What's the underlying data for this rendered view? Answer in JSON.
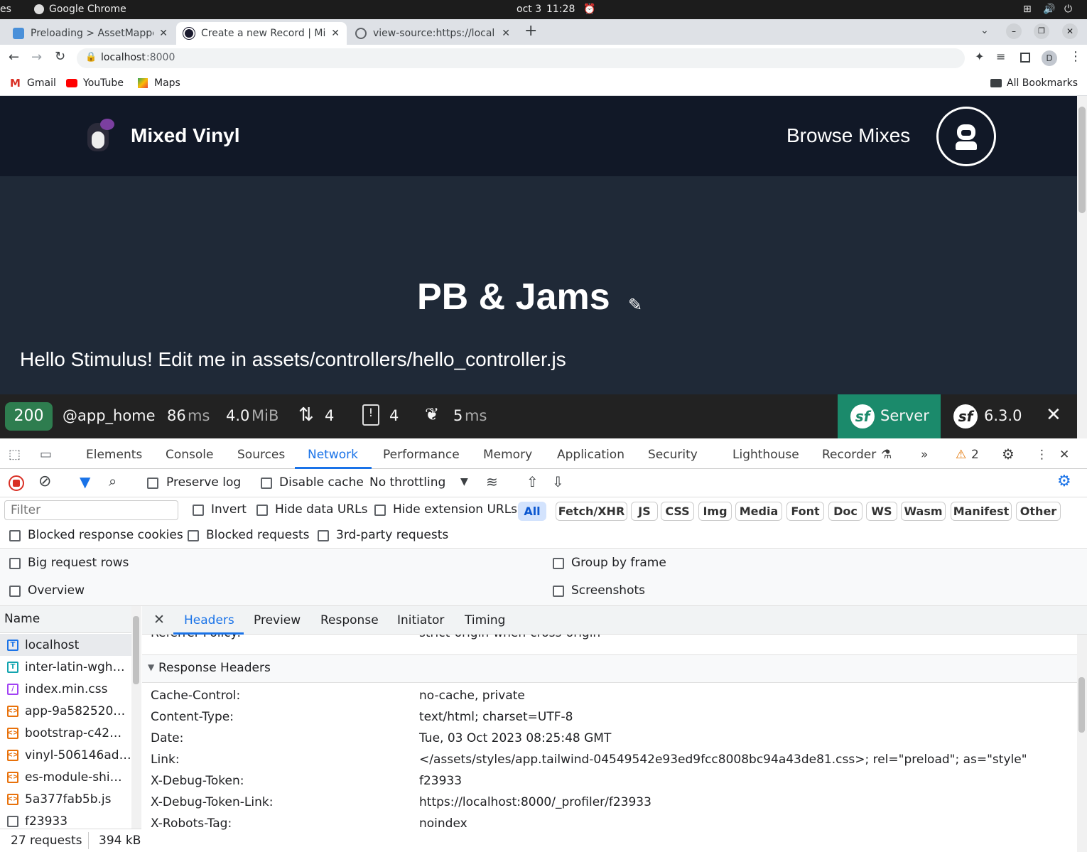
{
  "os": {
    "left_fragment": "es",
    "app": "Google Chrome",
    "date": "oct 3",
    "time": "11:28"
  },
  "tabs": [
    {
      "title": "Preloading > AssetMappe",
      "fav_color": "#4a90d9"
    },
    {
      "title": "Create a new Record | Mi",
      "fav_color": "#1a1a2e"
    },
    {
      "title": "view-source:https://local",
      "fav_color": "#5f6368"
    }
  ],
  "address": {
    "host": "localhost",
    "port": ":8000"
  },
  "bookmarks": {
    "items": [
      "Gmail",
      "YouTube",
      "Maps"
    ],
    "all": "All Bookmarks"
  },
  "profile_initial": "D",
  "site": {
    "brand": "Mixed Vinyl",
    "nav": "Browse Mixes",
    "title": "PB & Jams",
    "stimulus": "Hello Stimulus! Edit me in assets/controllers/hello_controller.js"
  },
  "sfbar": {
    "status": "200",
    "route": "@app_home",
    "time_val": "86",
    "time_unit": "ms",
    "mem_val": "4.0",
    "mem_unit": "MiB",
    "requests": "4",
    "logs": "4",
    "twig_val": "5",
    "twig_unit": "ms",
    "server": "Server",
    "version": "6.3.0"
  },
  "devtools": {
    "tabs": [
      "Elements",
      "Console",
      "Sources",
      "Network",
      "Performance",
      "Memory",
      "Application",
      "Security",
      "Lighthouse",
      "Recorder"
    ],
    "active_tab": "Network",
    "warnings": "2",
    "toolbar": {
      "preserve_log": "Preserve log",
      "disable_cache": "Disable cache",
      "throttling": "No throttling"
    },
    "filter": {
      "placeholder": "Filter",
      "invert": "Invert",
      "hide_data": "Hide data URLs",
      "hide_ext": "Hide extension URLs",
      "types": [
        "All",
        "Fetch/XHR",
        "JS",
        "CSS",
        "Img",
        "Media",
        "Font",
        "Doc",
        "WS",
        "Wasm",
        "Manifest",
        "Other"
      ],
      "blocked_cookies": "Blocked response cookies",
      "blocked_requests": "Blocked requests",
      "third_party": "3rd-party requests"
    },
    "options": {
      "big_rows": "Big request rows",
      "group_frame": "Group by frame",
      "overview": "Overview",
      "screenshots": "Screenshots"
    },
    "name_header": "Name",
    "requests": [
      {
        "name": "localhost",
        "icon": "T",
        "color": "#1a73e8"
      },
      {
        "name": "inter-latin-wgh…",
        "icon": "T",
        "color": "#12a4af"
      },
      {
        "name": "index.min.css",
        "icon": "/",
        "color": "#a142f4"
      },
      {
        "name": "app-9a582520…",
        "icon": "<>",
        "color": "#e8710a"
      },
      {
        "name": "bootstrap-c42…",
        "icon": "<>",
        "color": "#e8710a"
      },
      {
        "name": "vinyl-506146ad…",
        "icon": "<>",
        "color": "#e8710a"
      },
      {
        "name": "es-module-shi…",
        "icon": "<>",
        "color": "#e8710a"
      },
      {
        "name": "5a377fab5b.js",
        "icon": "<>",
        "color": "#e8710a"
      },
      {
        "name": "f23933",
        "icon": "",
        "color": "#5f6368"
      }
    ],
    "summary": {
      "count": "27 requests",
      "size": "394 kB"
    },
    "detail_tabs": [
      "Headers",
      "Preview",
      "Response",
      "Initiator",
      "Timing"
    ],
    "clipped_row": {
      "key": "Referrer-Policy:",
      "value": "strict-origin-when-cross-origin"
    },
    "section": "Response Headers",
    "headers": [
      {
        "k": "Cache-Control:",
        "v": "no-cache, private"
      },
      {
        "k": "Content-Type:",
        "v": "text/html; charset=UTF-8"
      },
      {
        "k": "Date:",
        "v": "Tue, 03 Oct 2023 08:25:48 GMT"
      },
      {
        "k": "Link:",
        "v": "</assets/styles/app.tailwind-04549542e93ed9fcc8008bc94a43de81.css>; rel=\"preload\"; as=\"style\""
      },
      {
        "k": "X-Debug-Token:",
        "v": "f23933"
      },
      {
        "k": "X-Debug-Token-Link:",
        "v": "https://localhost:8000/_profiler/f23933"
      },
      {
        "k": "X-Robots-Tag:",
        "v": "noindex"
      }
    ]
  }
}
